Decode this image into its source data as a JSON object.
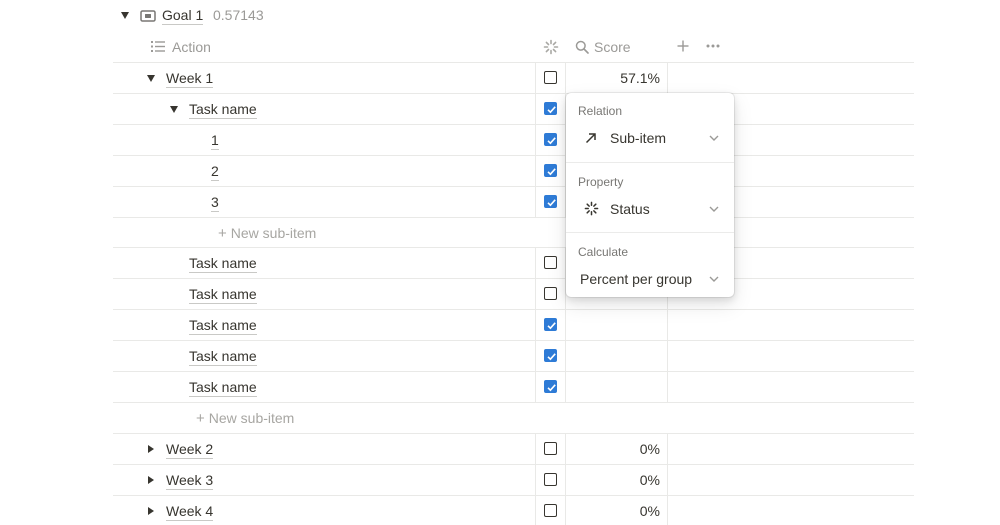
{
  "group": {
    "title": "Goal 1",
    "value": "0.57143"
  },
  "columns": {
    "action": "Action",
    "score": "Score"
  },
  "icons": {
    "expanded": "triangle-down-icon",
    "collapsed": "triangle-right-icon",
    "goal": "page-icon",
    "action_column": "list-icon",
    "status_column": "loading-spinner-icon",
    "score_column": "search-icon",
    "add": "plus-icon",
    "more": "ellipsis-icon",
    "relation": "arrow-up-right-icon",
    "chevron": "chevron-down-icon"
  },
  "rows": {
    "week1": {
      "title": "Week 1",
      "score": "57.1%",
      "status_checked": false
    },
    "task_a": {
      "title": "Task name",
      "status_checked": true
    },
    "sub1": {
      "title": "1",
      "status_checked": true
    },
    "sub2": {
      "title": "2",
      "status_checked": true
    },
    "sub3": {
      "title": "3",
      "status_checked": true
    },
    "new_sub_inner": "New sub-item",
    "task_b": {
      "title": "Task name",
      "status_checked": false
    },
    "task_c": {
      "title": "Task name",
      "status_checked": false
    },
    "task_d": {
      "title": "Task name",
      "status_checked": true
    },
    "task_e": {
      "title": "Task name",
      "status_checked": true
    },
    "task_f": {
      "title": "Task name",
      "status_checked": true
    },
    "new_sub_outer": "New sub-item",
    "week2": {
      "title": "Week 2",
      "score": "0%",
      "status_checked": false
    },
    "week3": {
      "title": "Week 3",
      "score": "0%",
      "status_checked": false
    },
    "week4": {
      "title": "Week 4",
      "score": "0%",
      "status_checked": false
    }
  },
  "popup": {
    "relation_label": "Relation",
    "relation_value": "Sub-item",
    "property_label": "Property",
    "property_value": "Status",
    "calculate_label": "Calculate",
    "calculate_value": "Percent per group"
  },
  "colors": {
    "checkbox_checked": "#2e7bd6",
    "text": "#37352f",
    "muted": "#9b9a97"
  }
}
